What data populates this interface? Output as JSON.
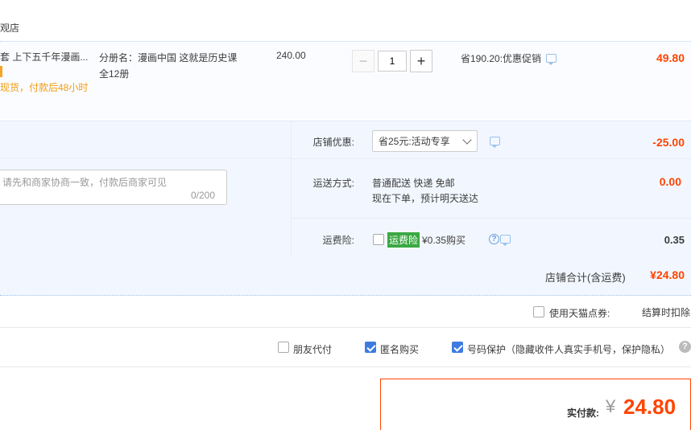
{
  "shop": {
    "name": "观店"
  },
  "item": {
    "title": "套 上下五千年漫画...",
    "note": "现货，付款后48小时",
    "spec_line1": "分册名：漫画中国 这就是历史课",
    "spec_line2": "全12册",
    "unit_price": "240.00",
    "quantity": "1",
    "minus": "−",
    "plus": "+",
    "promo": "省190.20:优惠促销",
    "subtotal": "49.80"
  },
  "memo": {
    "placeholder": "请先和商家协商一致，付款后商家可见",
    "count": "0/200"
  },
  "discount": {
    "label": "店铺优惠:",
    "selected": "省25元:活动专享",
    "amount": "-25.00"
  },
  "shipping": {
    "label": "运送方式:",
    "line1": "普通配送 快递 免邮",
    "line2": "现在下单，预计明天送达",
    "amount": "0.00"
  },
  "insurance": {
    "label": "运费险:",
    "badge": "运费险",
    "price": "¥0.35购买",
    "amount": "0.35",
    "help": "?"
  },
  "shop_total": {
    "label": "店铺合计(含运费)",
    "amount": "¥24.80"
  },
  "coupon": {
    "label": "使用天猫点券:",
    "note": "结算时扣除"
  },
  "options": {
    "friend_pay": "朋友代付",
    "anonymous": "匿名购买",
    "phone_protect": "号码保护（隐藏收件人真实手机号，保护隐私）",
    "help": "?"
  },
  "payment": {
    "label": "实付款:",
    "yen": "¥",
    "amount": "24.80"
  },
  "colors": {
    "accent": "#ff4400",
    "checkbox_on": "#3d7be0",
    "badge_green": "#3aa842"
  }
}
